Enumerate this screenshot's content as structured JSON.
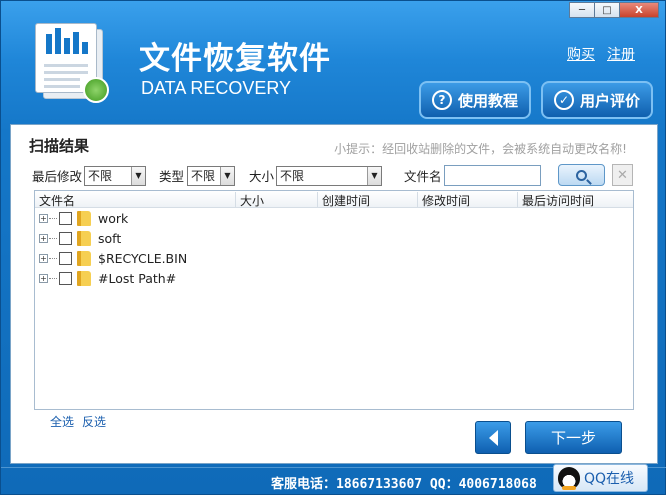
{
  "app": {
    "title_cn": "文件恢复软件",
    "title_en": "DATA RECOVERY"
  },
  "window_controls": {
    "minimize": "─",
    "maximize": "□",
    "close": "X"
  },
  "header": {
    "links": {
      "buy": "购买",
      "register": "注册"
    },
    "tutorial_button": "使用教程",
    "review_button": "用户评价"
  },
  "scan": {
    "title": "扫描结果",
    "tip": "小提示：经回收站删除的文件，会被系统自动更改名称!"
  },
  "filters": {
    "last_modified_label": "最后修改",
    "last_modified_value": "不限",
    "type_label": "类型",
    "type_value": "不限",
    "size_label": "大小",
    "size_value": "不限",
    "filename_label": "文件名",
    "filename_value": ""
  },
  "table": {
    "columns": [
      "文件名",
      "大小",
      "创建时间",
      "修改时间",
      "最后访问时间"
    ],
    "rows": [
      {
        "name": "work"
      },
      {
        "name": "soft"
      },
      {
        "name": "$RECYCLE.BIN"
      },
      {
        "name": "#Lost Path#"
      }
    ]
  },
  "selection": {
    "select_all": "全选",
    "invert": "反选"
  },
  "nav": {
    "next": "下一步"
  },
  "footer": {
    "contact": "客服电话：18667133607 QQ：4006718068",
    "qq_button": "QQ在线"
  }
}
